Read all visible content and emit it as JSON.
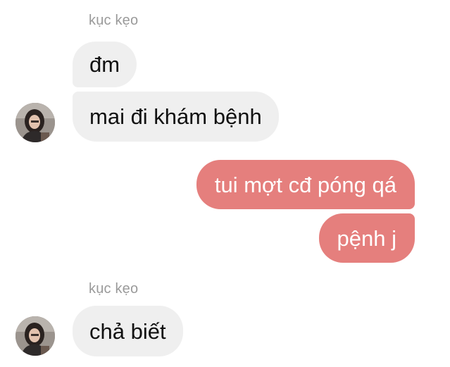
{
  "thread": {
    "groups": [
      {
        "sender": "kục kẹo",
        "direction": "incoming",
        "messages": [
          "đm",
          "mai đi khám bệnh"
        ]
      },
      {
        "sender": "",
        "direction": "outgoing",
        "messages": [
          "tui mợt cđ póng qá",
          "pệnh j"
        ]
      },
      {
        "sender": "kục kẹo",
        "direction": "incoming",
        "messages": [
          "chả biết"
        ]
      }
    ]
  },
  "colors": {
    "incoming_bubble": "#efefef",
    "outgoing_bubble": "#e57f7d",
    "sender_name": "#9a9a9a"
  },
  "icons": {
    "avatar": "contact-avatar-photo"
  }
}
